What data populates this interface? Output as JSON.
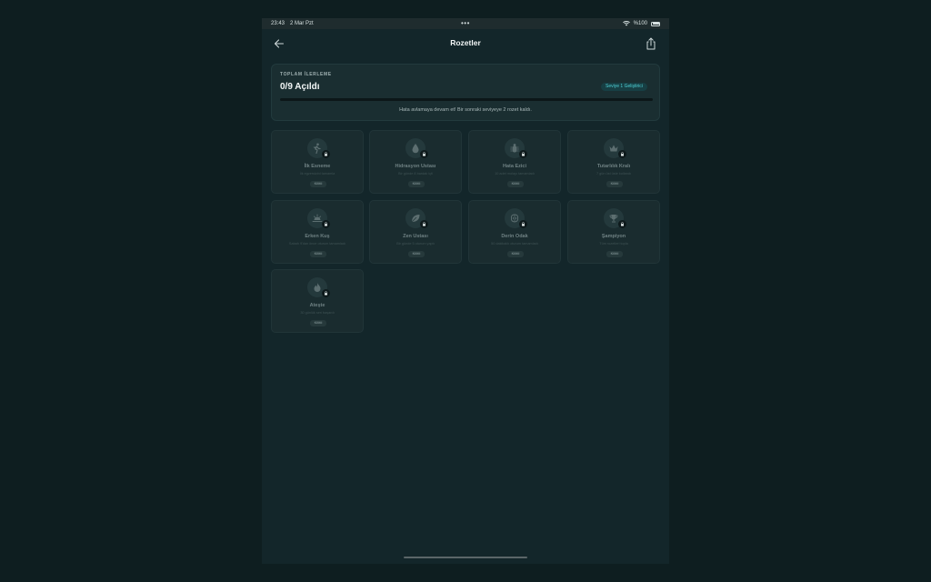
{
  "status_bar": {
    "time": "23:43",
    "date": "2 Mar Pzt",
    "dots": "•••",
    "battery_text": "%100"
  },
  "nav": {
    "title": "Rozetler",
    "back_icon": "arrow-left-icon",
    "share_icon": "share-icon"
  },
  "progress": {
    "caption": "TOPLAM İLERLEME",
    "value": "0/9 Açıldı",
    "level_badge": "Seviye 1 Geliştirici",
    "fraction": 0,
    "hint": "Hata avlamaya devam et! Bir sonraki seviyeye 2 rozet kaldı."
  },
  "badges": [
    {
      "name": "İlk Esneme",
      "desc": "İlk egzersizini tamamla",
      "status": "Kilitli",
      "icon": "walking-person-icon"
    },
    {
      "name": "Hidrasyon Ustası",
      "desc": "Bir günde 8 bardak içti",
      "status": "Kilitli",
      "icon": "water-drop-icon"
    },
    {
      "name": "Hata Ezici",
      "desc": "10 adet molayı tamamladı",
      "status": "Kilitli",
      "icon": "bug-icon"
    },
    {
      "name": "Tutarlılık Kralı",
      "desc": "7 gün üst üste kullandı",
      "status": "Kilitli",
      "icon": "crown-icon"
    },
    {
      "name": "Erken Kuş",
      "desc": "Sabah 9'dan önce oturum tamamladı",
      "status": "Kilitli",
      "icon": "sunrise-icon"
    },
    {
      "name": "Zen Ustası",
      "desc": "Bir günde 5 oturum yaptı",
      "status": "Kilitli",
      "icon": "leaf-icon"
    },
    {
      "name": "Derin Odak",
      "desc": "50 dakikalık oturum tamamladı",
      "status": "Kilitli",
      "icon": "brain-icon"
    },
    {
      "name": "Şampiyon",
      "desc": "Tüm rozetleri topla",
      "status": "Kilitli",
      "icon": "trophy-icon"
    },
    {
      "name": "Ateşte",
      "desc": "30 günlük seri başardı",
      "status": "Kilitli",
      "icon": "flame-icon"
    }
  ],
  "colors": {
    "accent": "#37c9cc",
    "background": "#13262a",
    "card": "#1a2c2f"
  }
}
